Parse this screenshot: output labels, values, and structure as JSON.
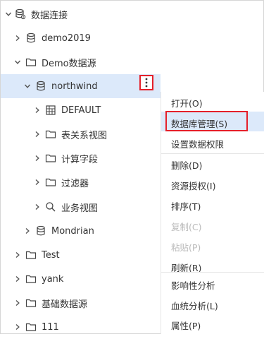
{
  "tree": {
    "root": {
      "label": "数据连接",
      "icon": "database-connection-icon"
    },
    "items": [
      {
        "label": "demo2019",
        "icon": "database-icon"
      },
      {
        "label": "Demo数据源",
        "icon": "folder-icon"
      },
      {
        "label": "northwind",
        "icon": "database-icon"
      },
      {
        "label": "DEFAULT",
        "icon": "table-grid-icon"
      },
      {
        "label": "表关系视图",
        "icon": "folder-icon"
      },
      {
        "label": "计算字段",
        "icon": "folder-icon"
      },
      {
        "label": "过滤器",
        "icon": "folder-icon"
      },
      {
        "label": "业务视图",
        "icon": "search-icon"
      },
      {
        "label": "Mondrian",
        "icon": "database-icon"
      },
      {
        "label": "Test",
        "icon": "folder-icon"
      },
      {
        "label": "yank",
        "icon": "folder-icon"
      },
      {
        "label": "基础数据源",
        "icon": "folder-icon"
      },
      {
        "label": "111",
        "icon": "folder-icon"
      }
    ],
    "more_button_icon": "more-vertical-icon"
  },
  "context_menu": {
    "items": [
      {
        "label": "打开(O)",
        "enabled": true
      },
      {
        "label": "数据库管理(S)",
        "enabled": true,
        "highlighted": true
      },
      {
        "label": "设置数据权限",
        "enabled": true
      },
      {
        "label": "删除(D)",
        "enabled": true
      },
      {
        "label": "资源授权(I)",
        "enabled": true
      },
      {
        "label": "排序(T)",
        "enabled": true
      },
      {
        "label": "复制(C)",
        "enabled": false
      },
      {
        "label": "粘贴(P)",
        "enabled": false
      },
      {
        "label": "刷新(R)",
        "enabled": true
      },
      {
        "label": "影响性分析",
        "enabled": true
      },
      {
        "label": "血统分析(L)",
        "enabled": true
      },
      {
        "label": "属性(P)",
        "enabled": true
      }
    ]
  },
  "colors": {
    "selection": "#dce9fa",
    "callout": "#e5202a",
    "disabled_text": "#bbbbbb"
  }
}
